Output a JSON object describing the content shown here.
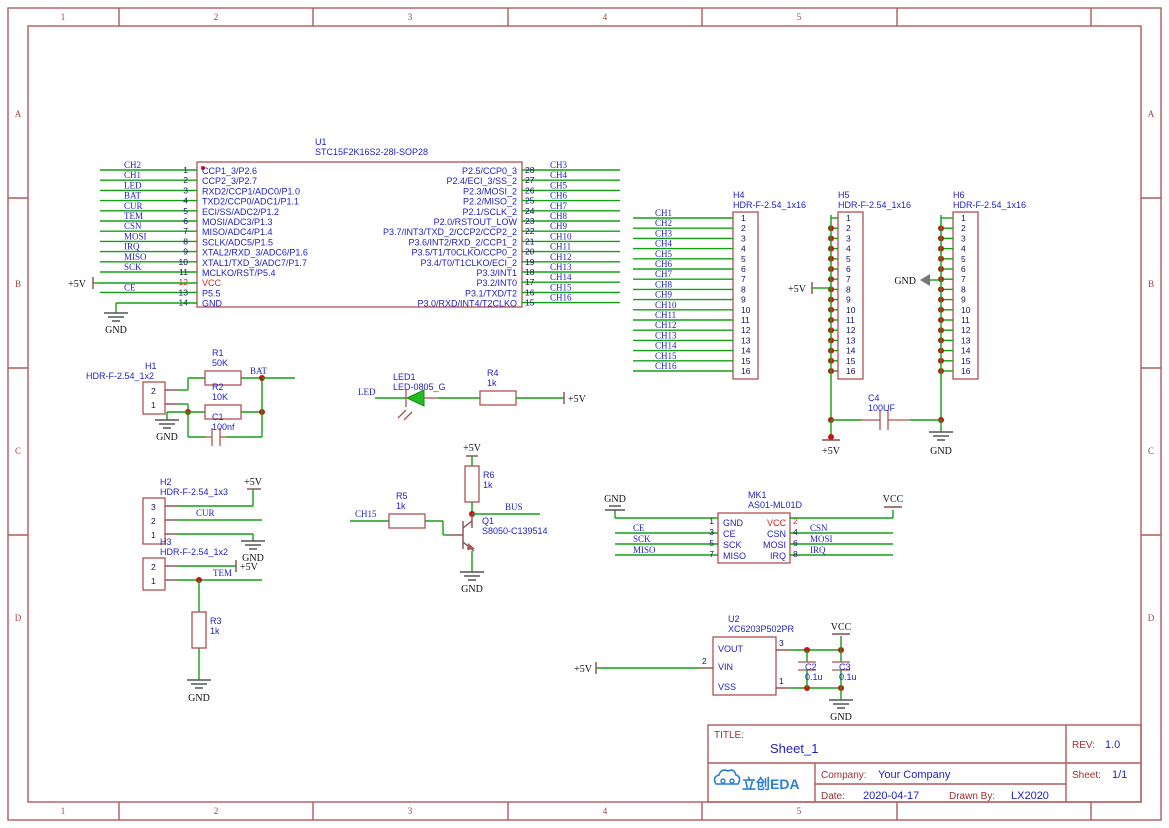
{
  "sheet": {
    "frame_columns": [
      "1",
      "2",
      "3",
      "4",
      "5"
    ],
    "frame_rows": [
      "A",
      "B",
      "C",
      "D"
    ]
  },
  "title_block": {
    "title_key": "TITLE:",
    "title_value": "Sheet_1",
    "rev_key": "REV:",
    "rev_value": "1.0",
    "company_key": "Company:",
    "company_value": "Your Company",
    "sheet_key": "Sheet:",
    "sheet_value": "1/1",
    "date_key": "Date:",
    "date_value": "2020-04-17",
    "drawn_key": "Drawn By:",
    "drawn_value": "LX2020",
    "logo_text": "立创EDA"
  },
  "u1": {
    "ref": "U1",
    "part": "STC15F2K16S2-28I-SOP28",
    "left_pins": [
      {
        "no": "1",
        "name": "CCP1_3/P2.6",
        "net": "CH2"
      },
      {
        "no": "2",
        "name": "CCP2_3/P2.7",
        "net": "CH1"
      },
      {
        "no": "3",
        "name": "RXD2/CCP1/ADC0/P1.0",
        "net": "LED"
      },
      {
        "no": "4",
        "name": "TXD2/CCP0/ADC1/P1.1",
        "net": "BAT"
      },
      {
        "no": "5",
        "name": "ECI/SS/ADC2/P1.2",
        "net": "CUR"
      },
      {
        "no": "6",
        "name": "MOSI/ADC3/P1.3",
        "net": "TEM"
      },
      {
        "no": "7",
        "name": "MISO/ADC4/P1.4",
        "net": "CSN"
      },
      {
        "no": "8",
        "name": "SCLK/ADC5/P1.5",
        "net": "MOSI"
      },
      {
        "no": "9",
        "name": "XTAL2/RXD_3/ADC6/P1.6",
        "net": "IRQ"
      },
      {
        "no": "10",
        "name": "XTAL1/TXD_3/ADC7/P1.7",
        "net": "MISO"
      },
      {
        "no": "11",
        "name": "MCLKO/RST/P5.4",
        "net": "SCK"
      },
      {
        "no": "12",
        "name": "VCC",
        "net": "+5V",
        "power": true
      },
      {
        "no": "13",
        "name": "P5.5",
        "net": "CE"
      },
      {
        "no": "14",
        "name": "GND",
        "net": "GND"
      }
    ],
    "right_pins": [
      {
        "no": "28",
        "name": "P2.5/CCP0_3",
        "net": "CH3"
      },
      {
        "no": "27",
        "name": "P2.4/ECI_3/SS_2",
        "net": "CH4"
      },
      {
        "no": "26",
        "name": "P2.3/MOSI_2",
        "net": "CH5"
      },
      {
        "no": "25",
        "name": "P2.2/MISO_2",
        "net": "CH6"
      },
      {
        "no": "24",
        "name": "P2.1/SCLK_2",
        "net": "CH7"
      },
      {
        "no": "23",
        "name": "P2.0/RSTOUT_LOW",
        "net": "CH8"
      },
      {
        "no": "22",
        "name": "P3.7/INT3/TXD_2/CCP2/CCP2_2",
        "net": "CH9"
      },
      {
        "no": "21",
        "name": "P3.6/INT2/RXD_2/CCP1_2",
        "net": "CH10"
      },
      {
        "no": "20",
        "name": "P3.5/T1/T0CLKO/CCP0_2",
        "net": "CH11"
      },
      {
        "no": "19",
        "name": "P3.4/T0/T1CLKO/ECI_2",
        "net": "CH12"
      },
      {
        "no": "18",
        "name": "P3.3/INT1",
        "net": "CH13"
      },
      {
        "no": "17",
        "name": "P3.2/INT0",
        "net": "CH14"
      },
      {
        "no": "16",
        "name": "P3.1/TXD/T2",
        "net": "CH15"
      },
      {
        "no": "15",
        "name": "P3.0/RXD/INT4/T2CLKO",
        "net": "CH16"
      }
    ],
    "gnd_label": "GND",
    "vcc_port": "+5V"
  },
  "h4": {
    "ref": "H4",
    "part": "HDR-F-2.54_1x16",
    "pins": [
      "1",
      "2",
      "3",
      "4",
      "5",
      "6",
      "7",
      "8",
      "9",
      "10",
      "11",
      "12",
      "13",
      "14",
      "15",
      "16"
    ],
    "nets": [
      "CH1",
      "CH2",
      "CH3",
      "CH4",
      "CH5",
      "CH6",
      "CH7",
      "CH8",
      "CH9",
      "CH10",
      "CH11",
      "CH12",
      "CH13",
      "CH14",
      "CH15",
      "CH16"
    ]
  },
  "h5": {
    "ref": "H5",
    "part": "HDR-F-2.54_1x16",
    "pins": [
      "1",
      "2",
      "3",
      "4",
      "5",
      "6",
      "7",
      "8",
      "9",
      "10",
      "11",
      "12",
      "13",
      "14",
      "15",
      "16"
    ],
    "port": "+5V",
    "rail_label": "+5V"
  },
  "h6": {
    "ref": "H6",
    "part": "HDR-F-2.54_1x16",
    "pins": [
      "1",
      "2",
      "3",
      "4",
      "5",
      "6",
      "7",
      "8",
      "9",
      "10",
      "11",
      "12",
      "13",
      "14",
      "15",
      "16"
    ],
    "port": "GND",
    "rail_label": "GND"
  },
  "c4": {
    "ref": "C4",
    "value": "100UF"
  },
  "h1": {
    "ref": "H1",
    "part": "HDR-F-2.54_1x2",
    "pins": [
      "2",
      "1"
    ],
    "gnd_label": "GND"
  },
  "r1": {
    "ref": "R1",
    "value": "50K"
  },
  "r2": {
    "ref": "R2",
    "value": "10K"
  },
  "c1": {
    "ref": "C1",
    "value": "100nf"
  },
  "bat_net": "BAT",
  "h2": {
    "ref": "H2",
    "part": "HDR-F-2.54_1x3",
    "pins": [
      "3",
      "2",
      "1"
    ],
    "net": "CUR",
    "port": "+5V",
    "gnd_label": "GND"
  },
  "h3": {
    "ref": "H3",
    "part": "HDR-F-2.54_1x2",
    "pins": [
      "2",
      "1"
    ],
    "net": "TEM",
    "port": "+5V"
  },
  "r3": {
    "ref": "R3",
    "value": "1k",
    "gnd_label": "GND"
  },
  "led1": {
    "ref": "LED1",
    "part": "LED-0805_G",
    "net": "LED",
    "port": "+5V"
  },
  "r4": {
    "ref": "R4",
    "value": "1k"
  },
  "q1": {
    "ref": "Q1",
    "part": "S8050-C139514",
    "base_net": "CH15",
    "out_net": "BUS",
    "port": "+5V",
    "gnd_label": "GND"
  },
  "r5": {
    "ref": "R5",
    "value": "1k"
  },
  "r6": {
    "ref": "R6",
    "value": "1k"
  },
  "mk1": {
    "ref": "MK1",
    "part": "AS01-ML01D",
    "left_pins": [
      {
        "no": "1",
        "name": "GND",
        "net": "GND",
        "power": false
      },
      {
        "no": "3",
        "name": "CE",
        "net": "CE"
      },
      {
        "no": "5",
        "name": "SCK",
        "net": "SCK"
      },
      {
        "no": "7",
        "name": "MISO",
        "net": "MISO"
      }
    ],
    "right_pins": [
      {
        "no": "2",
        "name": "VCC",
        "net": "VCC",
        "power": true
      },
      {
        "no": "4",
        "name": "CSN",
        "net": "CSN"
      },
      {
        "no": "6",
        "name": "MOSI",
        "net": "MOSI"
      },
      {
        "no": "8",
        "name": "IRQ",
        "net": "IRQ"
      }
    ],
    "gnd_port": "GND",
    "vcc_port": "VCC"
  },
  "u2": {
    "ref": "U2",
    "part": "XC6203P502PR",
    "pins": [
      {
        "no": "3",
        "name": "VOUT"
      },
      {
        "no": "2",
        "name": "VIN"
      },
      {
        "no": "1",
        "name": "VSS"
      }
    ],
    "in_port": "+5V",
    "out_port": "VCC",
    "gnd_label": "GND"
  },
  "c2": {
    "ref": "C2",
    "value": "0.1u"
  },
  "c3": {
    "ref": "C3",
    "value": "0.1u"
  }
}
